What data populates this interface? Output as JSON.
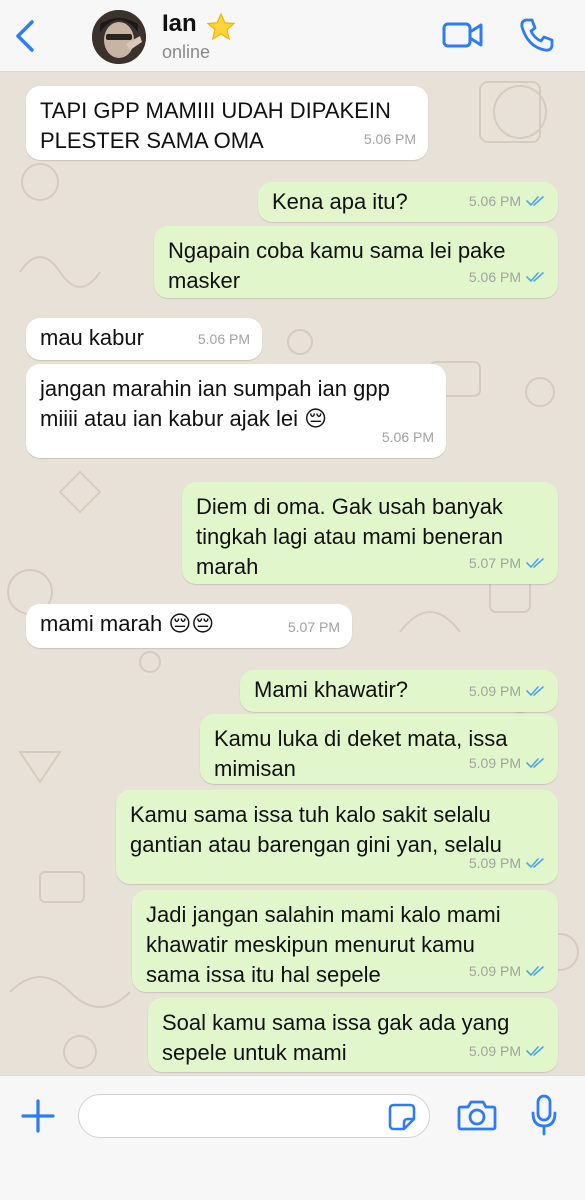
{
  "header": {
    "contact_name": "Ian",
    "status": "online",
    "back_icon": "chevron-left-icon",
    "video_icon": "video-camera-icon",
    "call_icon": "phone-icon",
    "accent_color": "#2d7cf6"
  },
  "messages": [
    {
      "dir": "in",
      "text": "TAPI GPP MAMIII UDAH DIPAKEIN\nPLESTER SAMA OMA",
      "time": "5.06 PM"
    },
    {
      "dir": "out",
      "text": "Kena apa itu?",
      "time": "5.06 PM",
      "read": true
    },
    {
      "dir": "out",
      "text": "Ngapain coba kamu sama lei pake\nmasker",
      "time": "5.06 PM",
      "read": true
    },
    {
      "dir": "in",
      "text": "mau kabur",
      "time": "5.06 PM"
    },
    {
      "dir": "in",
      "text": "jangan marahin ian sumpah ian gpp\nmiiii atau ian kabur ajak lei 😔",
      "time": "5.06 PM"
    },
    {
      "dir": "out",
      "text": "Diem di oma. Gak usah banyak\ntingkah lagi atau mami beneran\nmarah",
      "time": "5.07 PM",
      "read": true
    },
    {
      "dir": "in",
      "text": "mami marah 😔😔",
      "time": "5.07 PM"
    },
    {
      "dir": "out",
      "text": "Mami khawatir?",
      "time": "5.09 PM",
      "read": true
    },
    {
      "dir": "out",
      "text": "Kamu luka di deket mata, issa\nmimisan",
      "time": "5.09 PM",
      "read": true
    },
    {
      "dir": "out",
      "text": "Kamu sama issa tuh kalo sakit selalu\ngantian atau barengan gini yan, selalu",
      "time": "5.09 PM",
      "read": true
    },
    {
      "dir": "out",
      "text": "Jadi jangan salahin mami kalo mami\nkhawatir meskipun menurut kamu\nsama issa itu hal sepele",
      "time": "5.09 PM",
      "read": true
    },
    {
      "dir": "out",
      "text": "Soal kamu sama issa gak ada yang\nsepele untuk mami",
      "time": "5.09 PM",
      "read": true
    }
  ],
  "input_bar": {
    "placeholder": "",
    "plus_icon": "plus-icon",
    "sticker_icon": "sticker-icon",
    "camera_icon": "camera-icon",
    "mic_icon": "microphone-icon"
  },
  "colors": {
    "incoming_bubble": "#ffffff",
    "outgoing_bubble": "#e1f7cb",
    "read_ticks": "#4fa7e6"
  }
}
